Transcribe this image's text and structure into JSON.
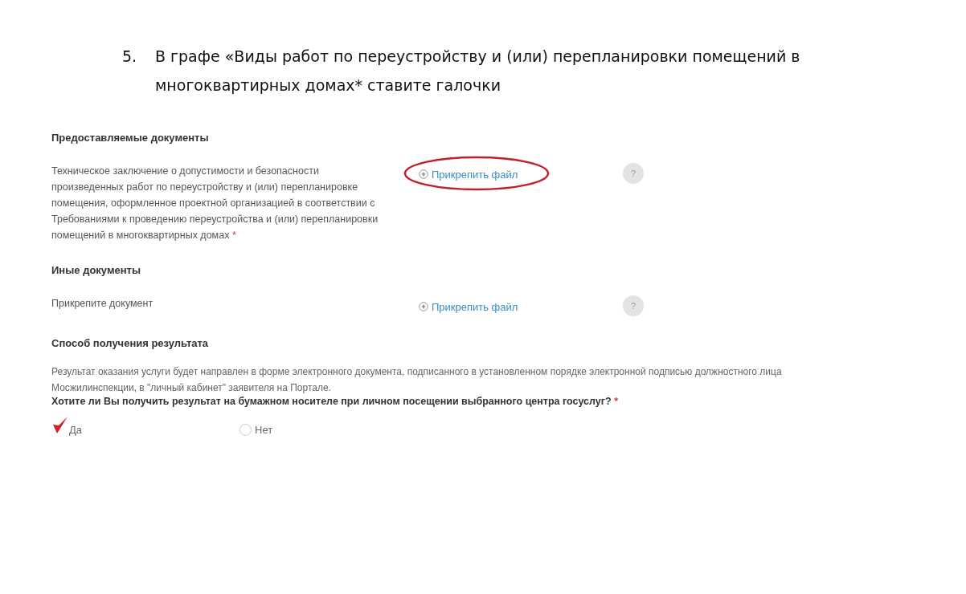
{
  "instruction": {
    "number": "5.",
    "text": "В графе «Виды работ по переустройству и (или) перепланировки помещений в многоквартирных домах* ставите галочки"
  },
  "sections": [
    {
      "title": "Предоставляемые документы",
      "documents": [
        {
          "label": "Техническое заключение о допустимости и безопасности произведенных работ по переустройству и (или) перепланировке помещения, оформленное проектной организацией в соответствии с Требованиями к проведению переустройства и (или) перепланировки помещений в многоквартирных домах",
          "required_mark": "*",
          "link": "Прикрепить файл",
          "help": "?",
          "circled": true
        }
      ]
    },
    {
      "title": "Иные документы",
      "documents": [
        {
          "label": "Прикрепите документ",
          "link": "Прикрепить файл",
          "help": "?",
          "circled": false
        }
      ]
    }
  ],
  "result": {
    "title": "Способ получения результата",
    "description": "Результат оказания услуги будет направлен в форме электронного документа, подписанного в установленном порядке электронной подписью должностного лица Мосжилинспекции, в \"личный кабинет\" заявителя на Портале.",
    "question": "Хотите ли Вы получить результат на бумажном носителе при личном посещении выбранного центра госуслуг?",
    "question_mark": "*",
    "options": [
      {
        "label": "Да",
        "selected": true
      },
      {
        "label": "Нет",
        "selected": false
      }
    ]
  }
}
